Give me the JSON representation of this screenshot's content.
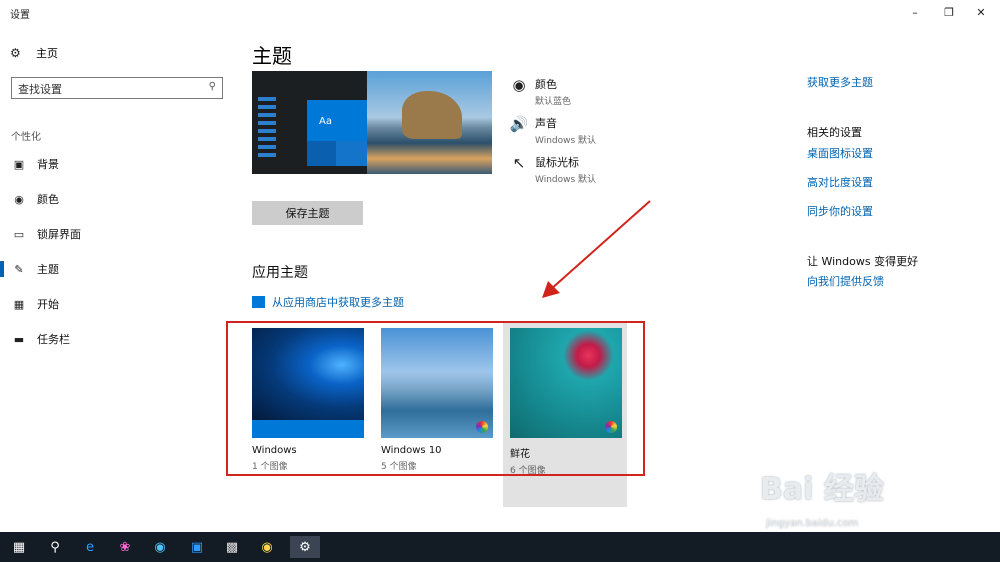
{
  "window": {
    "title": "设置",
    "min_icon": "minimize-icon",
    "max_icon": "maximize-icon",
    "close_icon": "close-icon"
  },
  "sidebar": {
    "home": {
      "label": "主页",
      "icon": "gear-icon"
    },
    "search": {
      "value": "查找设置",
      "icon": "search-icon"
    },
    "group": "个性化",
    "items": [
      {
        "label": "背景",
        "icon": "picture-icon",
        "active": false
      },
      {
        "label": "颜色",
        "icon": "palette-icon",
        "active": false
      },
      {
        "label": "锁屏界面",
        "icon": "lockscreen-icon",
        "active": false
      },
      {
        "label": "主题",
        "icon": "brush-icon",
        "active": true
      },
      {
        "label": "开始",
        "icon": "start-icon",
        "active": false
      },
      {
        "label": "任务栏",
        "icon": "taskbar-icon",
        "active": false
      }
    ]
  },
  "main": {
    "title": "主题",
    "preview": {
      "sample_text": "Aa"
    },
    "props": [
      {
        "name": "颜色",
        "value": "默认蓝色",
        "icon": "palette-icon"
      },
      {
        "name": "声音",
        "value": "Windows 默认",
        "icon": "speaker-icon"
      },
      {
        "name": "鼠标光标",
        "value": "Windows 默认",
        "icon": "cursor-icon"
      }
    ],
    "save_button": "保存主题",
    "apply_title": "应用主题",
    "store_link": "从应用商店中获取更多主题",
    "themes": [
      {
        "name": "Windows",
        "count": "1 个图像"
      },
      {
        "name": "Windows 10",
        "count": "5 个图像"
      },
      {
        "name": "鲜花",
        "count": "6 个图像"
      }
    ]
  },
  "right": {
    "get_more": "获取更多主题",
    "related_title": "相关的设置",
    "related": [
      "桌面图标设置",
      "高对比度设置",
      "同步你的设置"
    ],
    "better_title": "让 Windows 变得更好",
    "feedback": "向我们提供反馈"
  },
  "watermark": {
    "main": "Bai 经验",
    "sub": "jingyan.baidu.com"
  },
  "colors": {
    "accent": "#0063b1",
    "annotation": "#d0241c",
    "taskbar": "#131b24"
  }
}
